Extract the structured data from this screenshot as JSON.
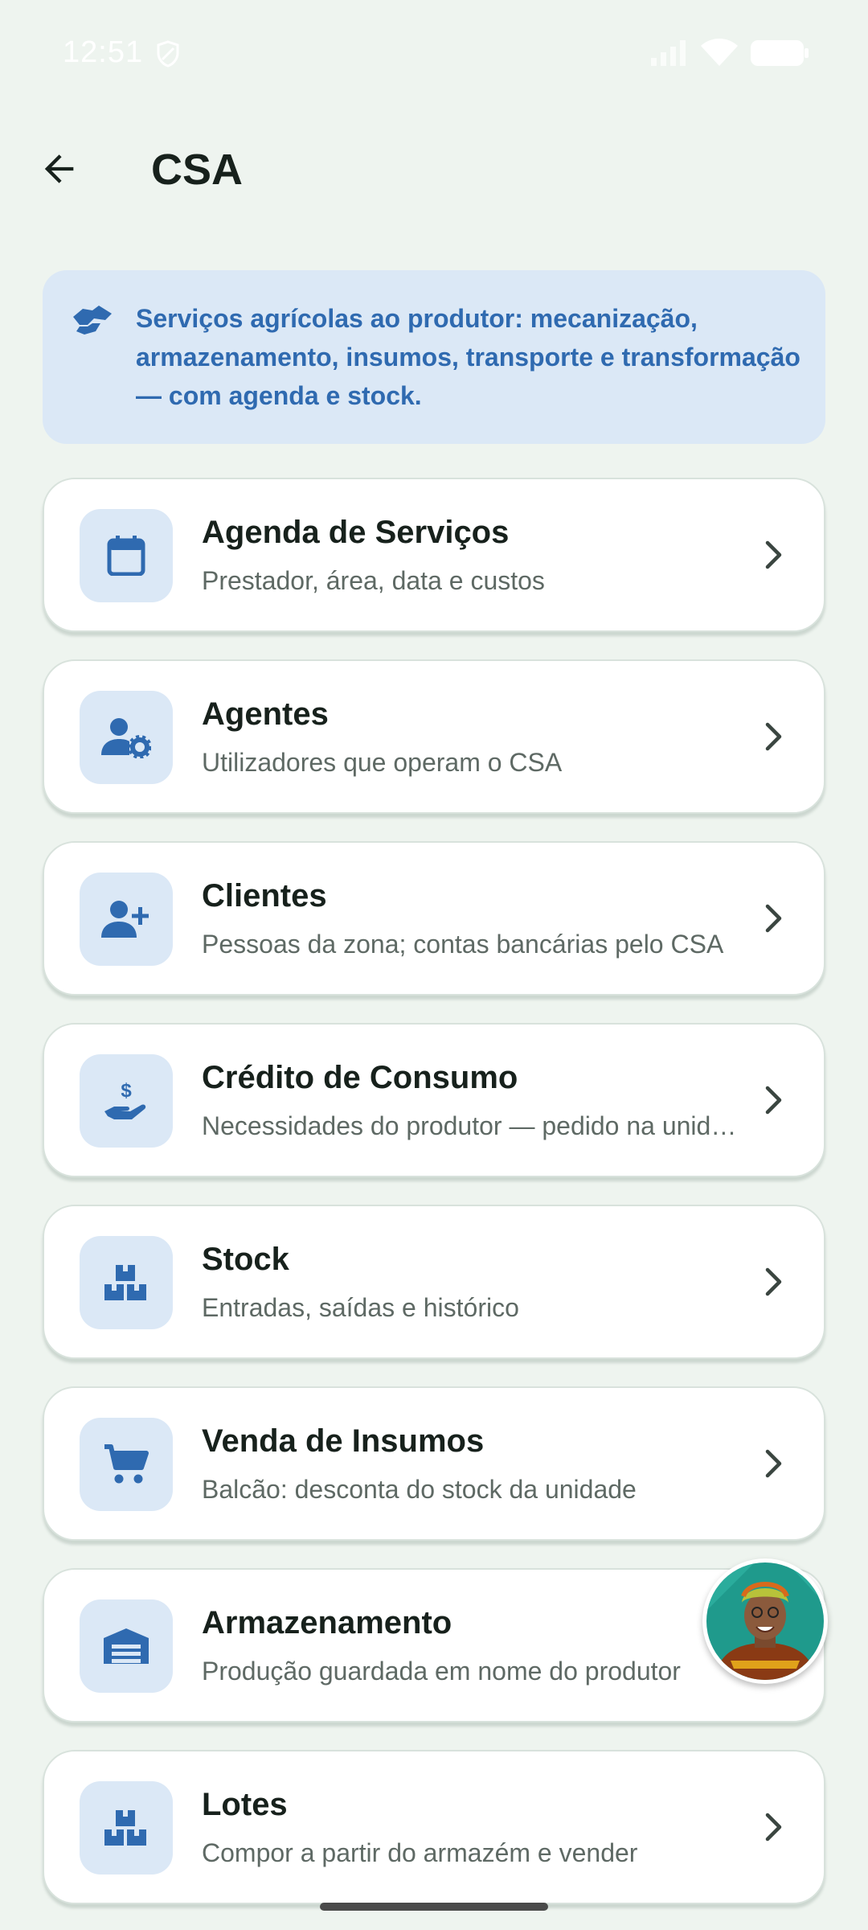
{
  "status_bar": {
    "time": "12:51"
  },
  "header": {
    "title": "CSA"
  },
  "banner": {
    "text": "Serviços agrícolas ao produtor: mecanização, armazenamento, insumos, transporte e transformação — com agenda e stock.",
    "icon": "handshake-icon"
  },
  "menu": {
    "items": [
      {
        "title": "Agenda de Serviços",
        "subtitle": "Prestador, área, data e custos",
        "icon": "calendar-icon"
      },
      {
        "title": "Agentes",
        "subtitle": "Utilizadores que operam o CSA",
        "icon": "user-gear-icon"
      },
      {
        "title": "Clientes",
        "subtitle": "Pessoas da zona; contas bancárias pelo CSA",
        "icon": "user-add-icon"
      },
      {
        "title": "Crédito de Consumo",
        "subtitle": "Necessidades do produtor — pedido na unid…",
        "icon": "hand-money-icon"
      },
      {
        "title": "Stock",
        "subtitle": "Entradas, saídas e histórico",
        "icon": "boxes-icon"
      },
      {
        "title": "Venda de Insumos",
        "subtitle": "Balcão: desconta do stock da unidade",
        "icon": "cart-icon"
      },
      {
        "title": "Armazenamento",
        "subtitle": "Produção guardada em nome do produtor",
        "icon": "warehouse-icon"
      },
      {
        "title": "Lotes",
        "subtitle": "Compor a partir do armazém e vender",
        "icon": "boxes-icon"
      }
    ]
  },
  "colors": {
    "background": "#eef4ef",
    "accent": "#2f6ab0",
    "icon_bg": "#dbe8f6",
    "text_primary": "#17211c",
    "text_secondary": "#5e6964"
  }
}
